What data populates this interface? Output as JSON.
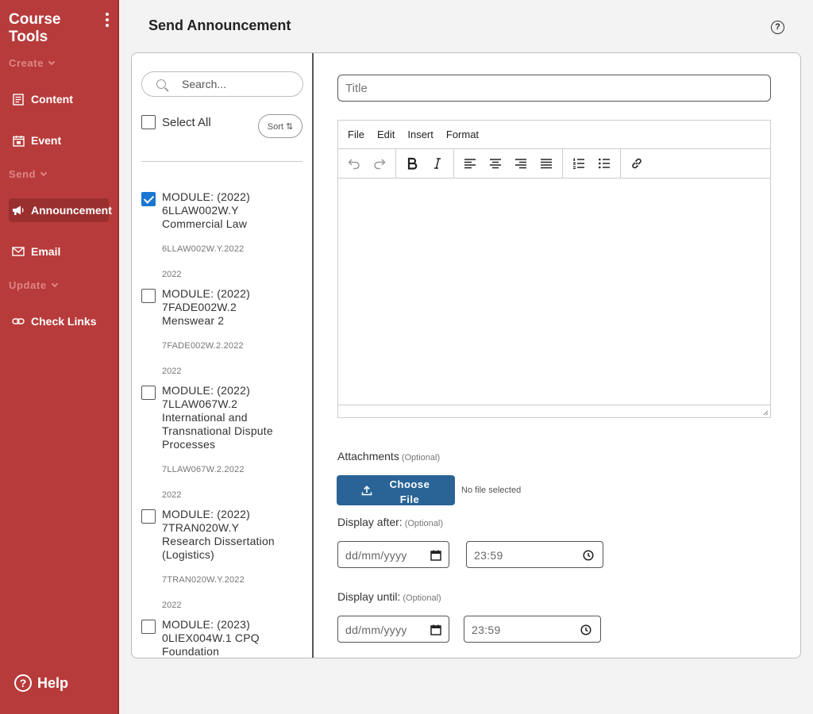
{
  "sidebar": {
    "brand": "Course Tools",
    "sections": {
      "create": "Create",
      "send": "Send",
      "update": "Update"
    },
    "items": {
      "content": "Content",
      "event": "Event",
      "announcement": "Announcement",
      "email": "Email",
      "check_links": "Check Links"
    },
    "help": "Help",
    "help_glyph": "?",
    "active_item": "Announcement"
  },
  "header": {
    "title": "Send Announcement",
    "help_glyph": "?"
  },
  "list": {
    "search_placeholder": "Search...",
    "select_all": "Select All",
    "sort_label": "Sort ⇅",
    "modules": [
      {
        "lines": [
          "MODULE: (2022)",
          "6LLAW002W.Y",
          "Commercial Law"
        ],
        "code": "6LLAW002W.Y.2022",
        "year": "2022",
        "checked": true
      },
      {
        "lines": [
          "MODULE: (2022)",
          "7FADE002W.2",
          "Menswear 2"
        ],
        "code": "7FADE002W.2.2022",
        "year": "2022",
        "checked": false
      },
      {
        "lines": [
          "MODULE: (2022)",
          "7LLAW067W.2",
          "International and",
          "Transnational Dispute",
          "Processes"
        ],
        "code": "7LLAW067W.2.2022",
        "year": "2022",
        "checked": false
      },
      {
        "lines": [
          "MODULE: (2022)",
          "7TRAN020W.Y",
          "Research Dissertation",
          "(Logistics)"
        ],
        "code": "7TRAN020W.Y.2022",
        "year": "2022",
        "checked": false
      },
      {
        "lines": [
          "MODULE: (2023)",
          "0LIEX004W.1 CPQ",
          "Foundation"
        ],
        "code": "",
        "year": "",
        "checked": false
      }
    ]
  },
  "form": {
    "title_placeholder": "Title",
    "menu": [
      "File",
      "Edit",
      "Insert",
      "Format"
    ],
    "attachments_label": "Attachments",
    "optional": "(Optional)",
    "choose_file": "Choose File",
    "no_file": "No file selected",
    "display_after_label": "Display after:",
    "display_until_label": "Display until:",
    "date_placeholder": "dd/mm/yyyy",
    "time_value": "23:59"
  },
  "colors": {
    "sidebar": "#b83b3b",
    "accent": "#2a6496",
    "checkbox": "#1976d2"
  }
}
